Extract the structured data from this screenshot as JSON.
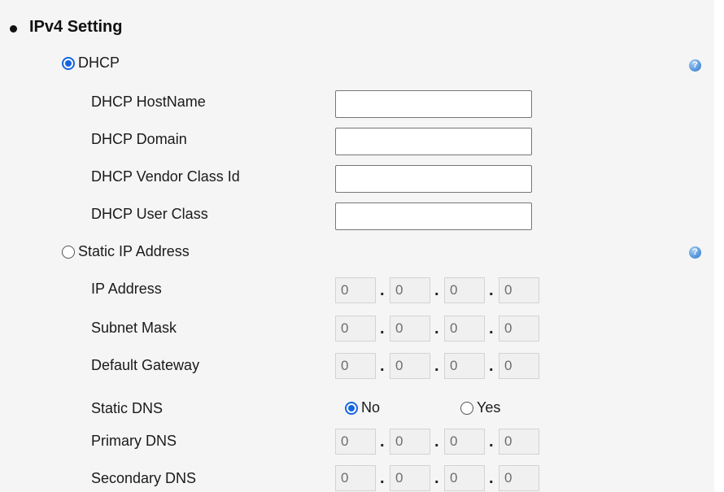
{
  "section": {
    "title": "IPv4 Setting"
  },
  "dhcp": {
    "label": "DHCP",
    "selected": true,
    "fields": [
      {
        "label": "DHCP HostName",
        "value": ""
      },
      {
        "label": "DHCP Domain",
        "value": ""
      },
      {
        "label": "DHCP Vendor Class Id",
        "value": ""
      },
      {
        "label": "DHCP User Class",
        "value": ""
      }
    ]
  },
  "static": {
    "label": "Static IP Address",
    "selected": false,
    "ip_address": {
      "label": "IP Address",
      "octets": [
        "0",
        "0",
        "0",
        "0"
      ]
    },
    "subnet_mask": {
      "label": "Subnet Mask",
      "octets": [
        "0",
        "0",
        "0",
        "0"
      ]
    },
    "default_gateway": {
      "label": "Default Gateway",
      "octets": [
        "0",
        "0",
        "0",
        "0"
      ]
    },
    "static_dns": {
      "label": "Static DNS",
      "options": [
        {
          "label": "No",
          "selected": true
        },
        {
          "label": "Yes",
          "selected": false
        }
      ]
    },
    "primary_dns": {
      "label": "Primary DNS",
      "octets": [
        "0",
        "0",
        "0",
        "0"
      ]
    },
    "secondary_dns": {
      "label": "Secondary DNS",
      "octets": [
        "0",
        "0",
        "0",
        "0"
      ]
    }
  },
  "help": {
    "glyph": "?",
    "icon": "help-icon",
    "color": "#4a8fd9"
  },
  "colors": {
    "accent": "#1565e0",
    "panel_bg": "#f5f5f5"
  }
}
